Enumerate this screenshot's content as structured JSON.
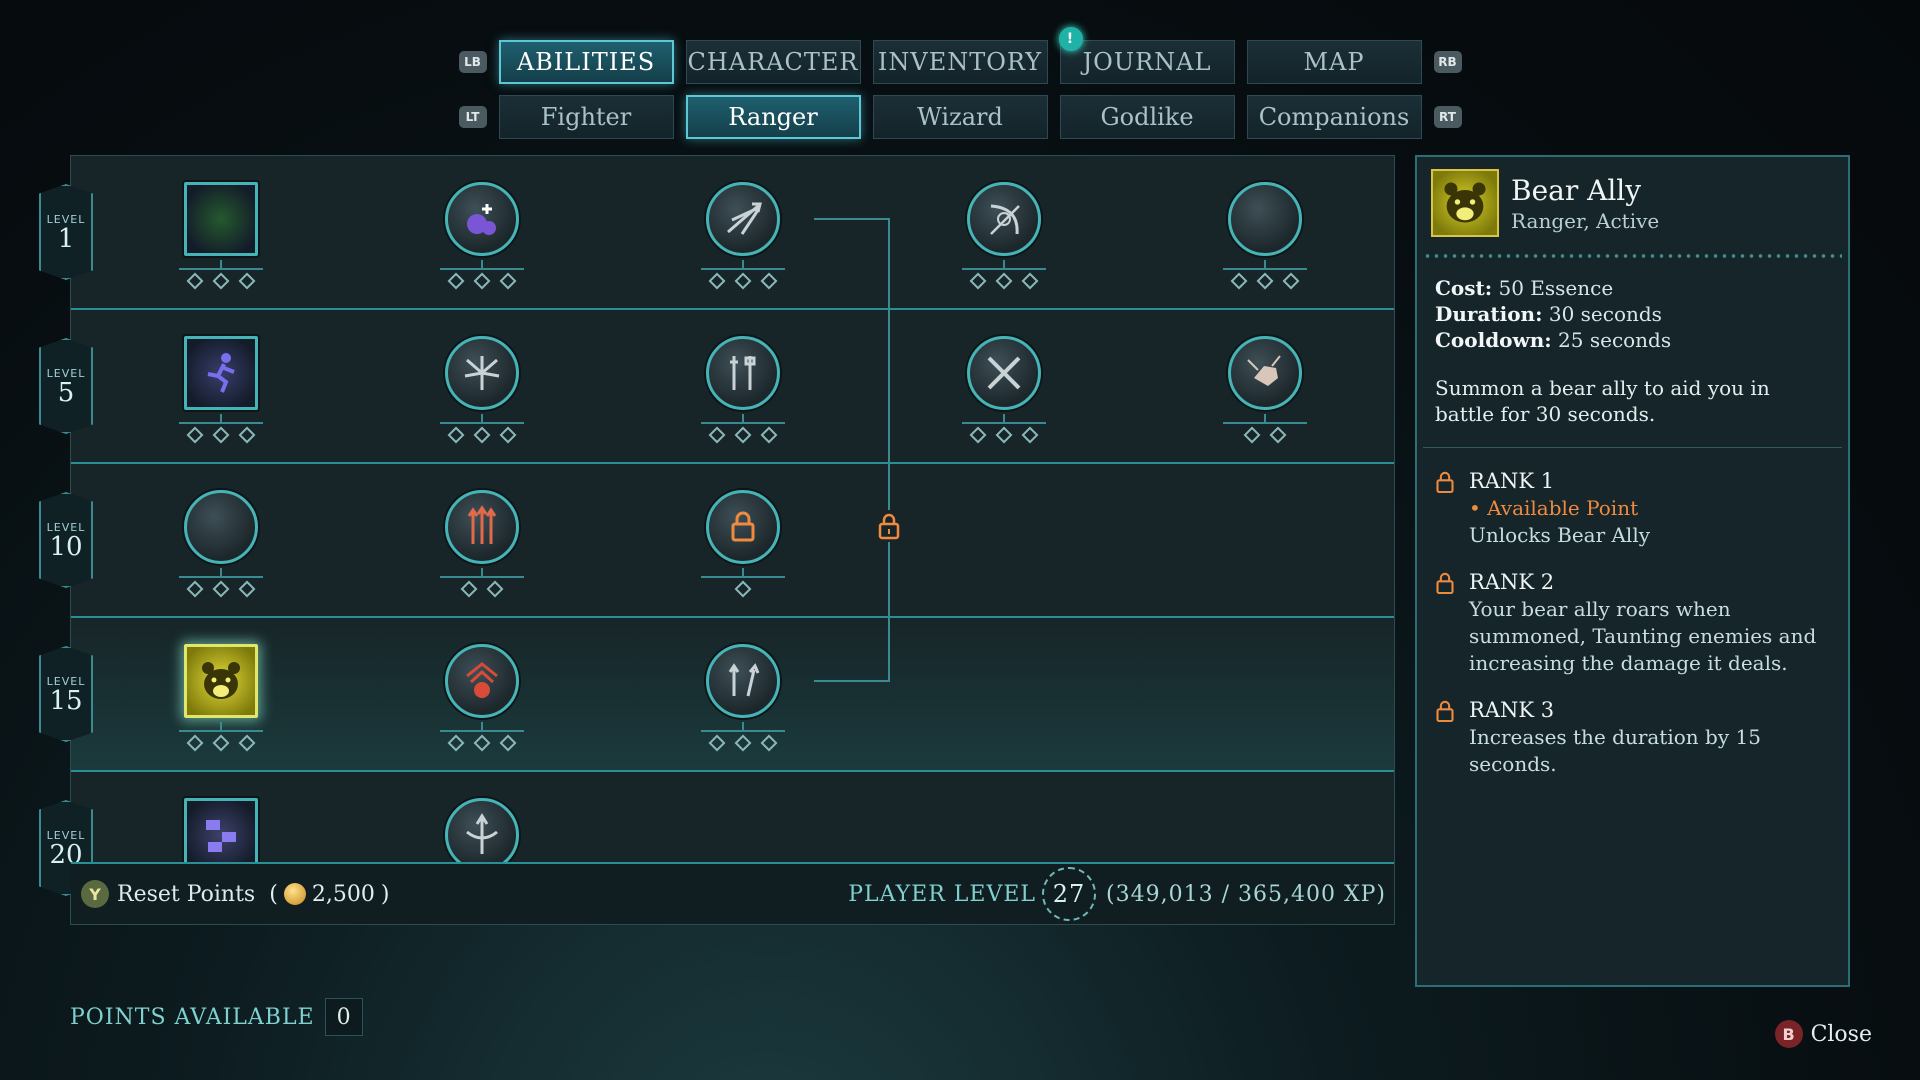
{
  "tabs": {
    "left_shoulder": "LB",
    "right_shoulder": "RB",
    "items": [
      {
        "label": "ABILITIES",
        "active": true
      },
      {
        "label": "CHARACTER",
        "active": false
      },
      {
        "label": "INVENTORY",
        "active": false
      },
      {
        "label": "JOURNAL",
        "active": false,
        "notification": "!"
      },
      {
        "label": "MAP",
        "active": false
      }
    ]
  },
  "subtabs": {
    "left_trigger": "LT",
    "right_trigger": "RT",
    "items": [
      {
        "label": "Fighter",
        "active": false
      },
      {
        "label": "Ranger",
        "active": true
      },
      {
        "label": "Wizard",
        "active": false
      },
      {
        "label": "Godlike",
        "active": false
      },
      {
        "label": "Companions",
        "active": false
      }
    ]
  },
  "levels": [
    {
      "label": "LEVEL",
      "value": "1"
    },
    {
      "label": "LEVEL",
      "value": "5"
    },
    {
      "label": "LEVEL",
      "value": "10"
    },
    {
      "label": "LEVEL",
      "value": "15"
    },
    {
      "label": "LEVEL",
      "value": "20"
    }
  ],
  "abilities": [
    {
      "row": 0,
      "col": 0,
      "icon": "vine-icon",
      "shape": "square",
      "color": "#3fc23a",
      "rank_pips": 3
    },
    {
      "row": 0,
      "col": 1,
      "icon": "potion-icon",
      "shape": "round",
      "color": "#7a56d6",
      "rank_pips": 3
    },
    {
      "row": 0,
      "col": 2,
      "icon": "multi-arrow-icon",
      "shape": "round",
      "color": "#c9d3d6",
      "rank_pips": 3
    },
    {
      "row": 0,
      "col": 3,
      "icon": "bow-aim-icon",
      "shape": "round",
      "color": "#c9d3d6",
      "rank_pips": 3
    },
    {
      "row": 0,
      "col": 4,
      "icon": "claw-swipe-icon",
      "shape": "round",
      "color": "#c6a24a",
      "rank_pips": 3
    },
    {
      "row": 1,
      "col": 0,
      "icon": "dash-figure-icon",
      "shape": "square",
      "color": "#7a6ef0",
      "rank_pips": 3
    },
    {
      "row": 1,
      "col": 1,
      "icon": "arrow-burst-icon",
      "shape": "round",
      "color": "#c9d3d6",
      "rank_pips": 3
    },
    {
      "row": 1,
      "col": 2,
      "icon": "weapons-icon",
      "shape": "round",
      "color": "#c9d3d6",
      "rank_pips": 3
    },
    {
      "row": 1,
      "col": 3,
      "icon": "crossed-blades-icon",
      "shape": "round",
      "color": "#c9d3d6",
      "rank_pips": 3
    },
    {
      "row": 1,
      "col": 4,
      "icon": "fist-strike-icon",
      "shape": "round",
      "color": "#d8c7b8",
      "rank_pips": 2
    },
    {
      "row": 2,
      "col": 0,
      "icon": "leap-icon",
      "shape": "round",
      "color": "#9a7cf0",
      "rank_pips": 3
    },
    {
      "row": 2,
      "col": 1,
      "icon": "triple-arrow-icon",
      "shape": "round",
      "color": "#e06a4a",
      "rank_pips": 2
    },
    {
      "row": 2,
      "col": 2,
      "icon": "locked-ability-icon",
      "shape": "round",
      "color": "#ef8a3e",
      "rank_pips": 1
    },
    {
      "row": 3,
      "col": 0,
      "icon": "bear-icon",
      "shape": "square",
      "color": "#d7ce2a",
      "rank_pips": 3,
      "selected": true
    },
    {
      "row": 3,
      "col": 1,
      "icon": "beast-skull-icon",
      "shape": "round",
      "color": "#d84a3a",
      "rank_pips": 3
    },
    {
      "row": 3,
      "col": 2,
      "icon": "arrow-rain-icon",
      "shape": "round",
      "color": "#c9d3d6",
      "rank_pips": 3
    },
    {
      "row": 4,
      "col": 0,
      "icon": "flurry-icon",
      "shape": "square",
      "color": "#8a7cf0",
      "rank_pips": 3
    },
    {
      "row": 4,
      "col": 1,
      "icon": "crossbow-icon",
      "shape": "round",
      "color": "#c9d3d6",
      "rank_pips": 3
    }
  ],
  "footer": {
    "reset_button": "Y",
    "reset_label": "Reset Points",
    "reset_open": "(",
    "reset_cost": "2,500",
    "reset_close": ")",
    "player_level_label": "PLAYER LEVEL",
    "player_level": "27",
    "xp": "(349,013 / 365,400 XP)"
  },
  "points": {
    "label": "POINTS AVAILABLE",
    "value": "0"
  },
  "detail": {
    "name": "Bear Ally",
    "subtitle": "Ranger, Active",
    "cost_label": "Cost:",
    "cost": "50 Essence",
    "duration_label": "Duration:",
    "duration": "30 seconds",
    "cooldown_label": "Cooldown:",
    "cooldown": "25 seconds",
    "description": "Summon a bear ally to aid you in battle for 30 seconds.",
    "ranks": [
      {
        "title": "RANK 1",
        "available": "• Available Point",
        "text": "Unlocks Bear Ally"
      },
      {
        "title": "RANK 2",
        "text": "Your bear ally roars when summoned, Taunting enemies and increasing the damage it deals."
      },
      {
        "title": "RANK 3",
        "text": "Increases the duration by 15 seconds."
      }
    ]
  },
  "close": {
    "button": "B",
    "label": "Close"
  }
}
